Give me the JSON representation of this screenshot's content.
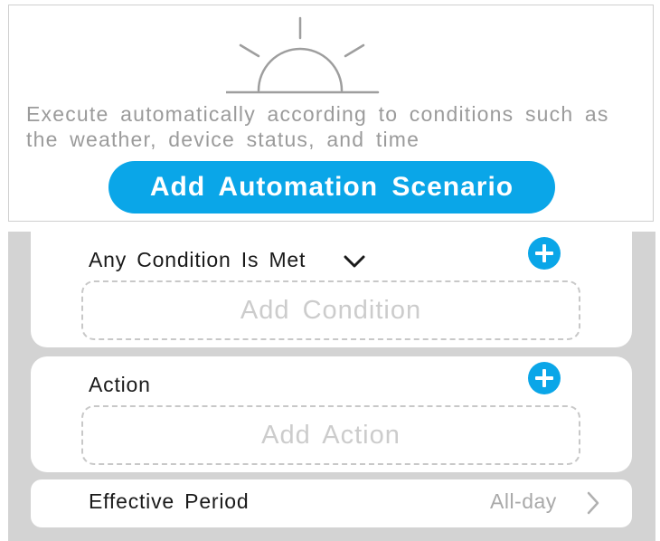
{
  "header": {
    "description": "Execute automatically according to conditions such as the weather, device status, and time",
    "add_button_label": "Add Automation Scenario"
  },
  "condition_section": {
    "title": "Any Condition Is Met",
    "add_placeholder": "Add Condition"
  },
  "action_section": {
    "title": "Action",
    "add_placeholder": "Add Action"
  },
  "period_section": {
    "label": "Effective Period",
    "value": "All-day"
  },
  "colors": {
    "accent": "#0aa6e8",
    "muted_text": "#9b9b9b",
    "background_gray": "#d3d3d3"
  },
  "icons": [
    "sunrise-icon",
    "chevron-down-icon",
    "plus-icon",
    "chevron-right-icon"
  ]
}
